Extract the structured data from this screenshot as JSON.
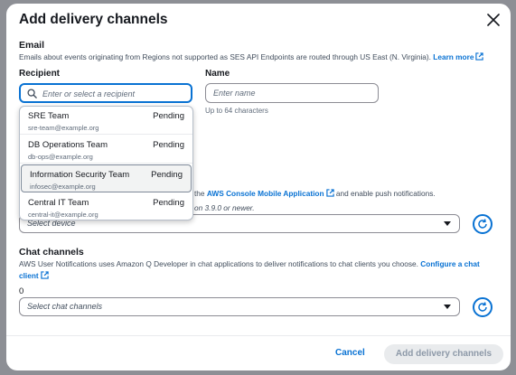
{
  "modal": {
    "title": "Add delivery channels"
  },
  "email": {
    "heading": "Email",
    "description": "Emails about events originating from Regions not supported as SES API Endpoints are routed through US East (N. Virginia).",
    "learn_more": "Learn more",
    "recipient_label": "Recipient",
    "recipient_placeholder": "Enter or select a recipient",
    "name_label": "Name",
    "name_placeholder": "Enter name",
    "name_hint": "Up to 64 characters"
  },
  "recipients": [
    {
      "name": "SRE Team",
      "email": "sre-team@example.org",
      "status": "Pending"
    },
    {
      "name": "DB Operations Team",
      "email": "db-ops@example.org",
      "status": "Pending"
    },
    {
      "name": "Information Security Team",
      "email": "infosec@example.org",
      "status": "Pending"
    },
    {
      "name": "Central IT Team",
      "email": "central-it@example.org",
      "status": "Pending"
    }
  ],
  "mobile": {
    "text_prefix": "the",
    "app_link": "AWS Console Mobile Application",
    "text_suffix": "and enable push notifications.",
    "version_text": "on 3.9.0 or newer.",
    "select_placeholder": "Select device"
  },
  "chat": {
    "heading": "Chat channels",
    "description": "AWS User Notifications uses Amazon Q Developer in chat applications to deliver notifications to chat clients you choose.",
    "configure_link_a": "Configure a chat",
    "configure_link_b": "client",
    "count": "0",
    "select_placeholder": "Select chat channels"
  },
  "footer": {
    "cancel": "Cancel",
    "submit": "Add delivery channels"
  },
  "colors": {
    "accent": "#0972d3",
    "text": "#16191f",
    "muted": "#5f6b7a",
    "overlay": "#8d8f95",
    "disabled_bg": "#e9ebed"
  }
}
